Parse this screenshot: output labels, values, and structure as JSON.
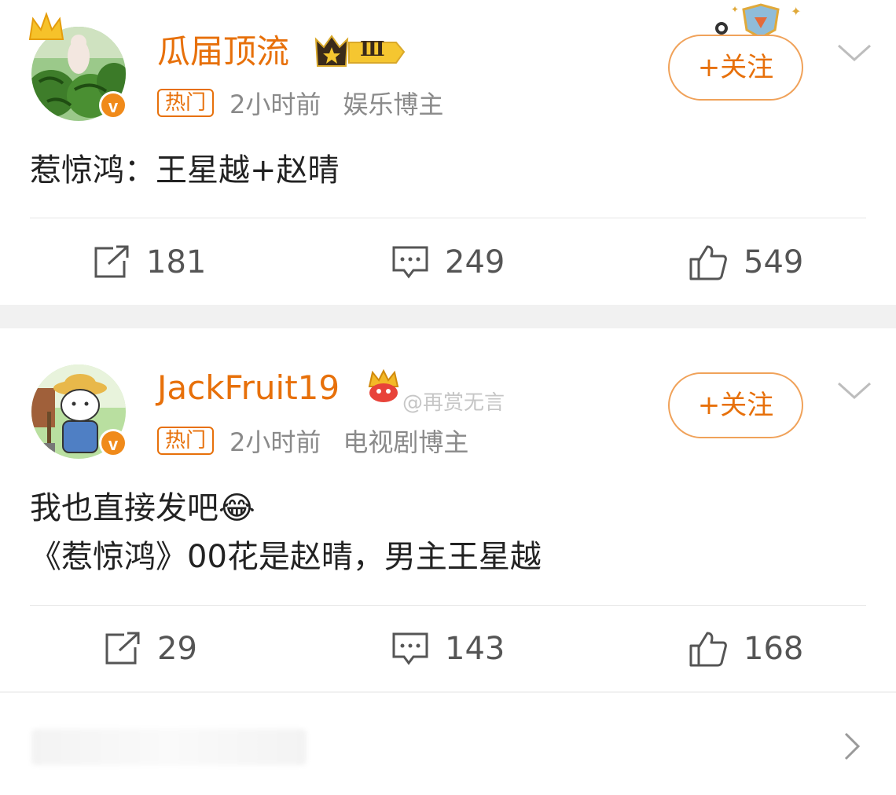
{
  "posts": [
    {
      "username": "瓜届顶流",
      "level_badge": "Ⅲ",
      "hot_tag": "热门",
      "time": "2小时前",
      "role": "娱乐博主",
      "follow_label": "+关注",
      "content_lines": [
        "惹惊鸿：王星越+赵晴"
      ],
      "repost_count": "181",
      "comment_count": "249",
      "like_count": "549"
    },
    {
      "username": "JackFruit19",
      "watermark": "@再赏无言",
      "hot_tag": "热门",
      "time": "2小时前",
      "role": "电视剧博主",
      "follow_label": "+关注",
      "content_lines": [
        "我也直接发吧😂",
        "《惹惊鸿》00花是赵晴，男主王星越"
      ],
      "repost_count": "29",
      "comment_count": "143",
      "like_count": "168"
    }
  ],
  "colors": {
    "accent": "#e7700a",
    "follow_border": "#f0a25a",
    "meta_gray": "#8a8a8a",
    "gap": "#f1f1f1"
  },
  "icons": [
    "repost-icon",
    "comment-icon",
    "like-icon",
    "chevron-down-icon",
    "chevron-right-icon",
    "verified-v-icon",
    "crown-icon"
  ]
}
